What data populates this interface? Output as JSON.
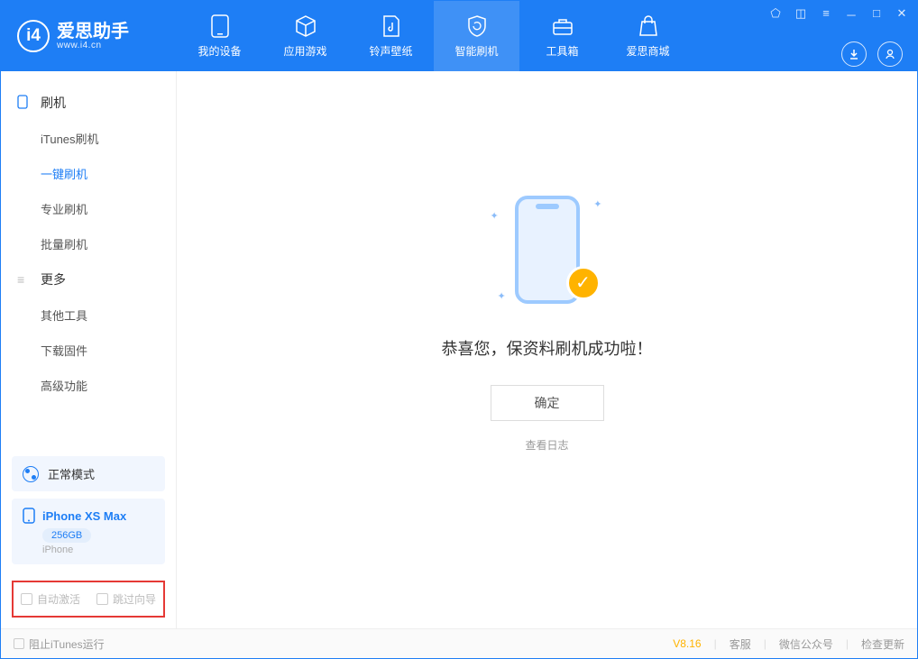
{
  "app": {
    "name": "爱思助手",
    "url": "www.i4.cn"
  },
  "nav": {
    "items": [
      {
        "label": "我的设备"
      },
      {
        "label": "应用游戏"
      },
      {
        "label": "铃声壁纸"
      },
      {
        "label": "智能刷机"
      },
      {
        "label": "工具箱"
      },
      {
        "label": "爱思商城"
      }
    ],
    "active_index": 3
  },
  "sidebar": {
    "section1": {
      "title": "刷机",
      "items": [
        {
          "label": "iTunes刷机"
        },
        {
          "label": "一键刷机"
        },
        {
          "label": "专业刷机"
        },
        {
          "label": "批量刷机"
        }
      ],
      "active_index": 1
    },
    "section2": {
      "title": "更多",
      "items": [
        {
          "label": "其他工具"
        },
        {
          "label": "下载固件"
        },
        {
          "label": "高级功能"
        }
      ]
    },
    "status": {
      "label": "正常模式"
    },
    "device": {
      "name": "iPhone XS Max",
      "capacity": "256GB",
      "sub": "iPhone"
    },
    "checks": {
      "auto_activate": "自动激活",
      "skip_guide": "跳过向导"
    }
  },
  "main": {
    "success_text": "恭喜您，保资料刷机成功啦！",
    "ok_button": "确定",
    "view_log": "查看日志"
  },
  "footer": {
    "block_itunes": "阻止iTunes运行",
    "version": "V8.16",
    "support": "客服",
    "wechat": "微信公众号",
    "check_update": "检查更新"
  }
}
